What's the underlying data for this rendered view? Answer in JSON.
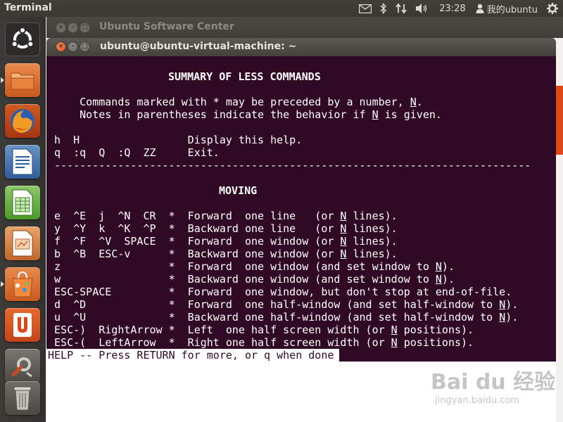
{
  "top_panel": {
    "app_name": "Terminal",
    "clock": "23:28",
    "user": "我的ubuntu",
    "icons": [
      "mail-icon",
      "bluetooth-icon",
      "network-icon",
      "volume-icon",
      "user-icon",
      "gear-icon"
    ]
  },
  "launcher": {
    "items": [
      {
        "name": "dash-home-button",
        "icon": "ubuntu-logo-icon"
      },
      {
        "name": "files-button",
        "icon": "folder-icon"
      },
      {
        "name": "firefox-button",
        "icon": "firefox-icon"
      },
      {
        "name": "writer-button",
        "icon": "writer-icon"
      },
      {
        "name": "calc-button",
        "icon": "calc-icon"
      },
      {
        "name": "impress-button",
        "icon": "impress-icon"
      },
      {
        "name": "software-center-button",
        "icon": "software-center-icon"
      },
      {
        "name": "ubuntu-one-button",
        "icon": "ubuntu-one-icon"
      },
      {
        "name": "system-settings-button",
        "icon": "settings-icon"
      },
      {
        "name": "trash-button",
        "icon": "trash-icon"
      }
    ]
  },
  "background_window": {
    "title": "Ubuntu Software Center"
  },
  "terminal": {
    "title": "ubuntu@ubuntu-virtual-machine: ~",
    "lines": {
      "l1": "SUMMARY OF LESS COMMANDS",
      "l2a": "     Commands marked with * may be preceded by a number, ",
      "l2n": "N",
      "l2b": ".",
      "l3a": "     Notes in parentheses indicate the behavior if ",
      "l3n": "N",
      "l3b": " is given.",
      "l4": " h  H                 Display this help.",
      "l5": " q  :q  Q  :Q  ZZ     Exit.",
      "l6": "---------------------------------------------------------------------------",
      "l7": "MOVING",
      "m1a": " e  ^E  j  ^N  CR  *  Forward  one line   (or ",
      "m1b": " lines).",
      "m2a": " y  ^Y  k  ^K  ^P  *  Backward one line   (or ",
      "m2b": " lines).",
      "m3a": " f  ^F  ^V  SPACE  *  Forward  one window (or ",
      "m3b": " lines).",
      "m4a": " b  ^B  ESC-v      *  Backward one window (or ",
      "m4b": " lines).",
      "m5a": " z                 *  Forward  one window (and set window to ",
      "m5b": ").",
      "m6a": " w                 *  Backward one window (and set window to ",
      "m6b": ").",
      "m7": " ESC-SPACE         *  Forward  one window, but don't stop at end-of-file.",
      "m8a": " d  ^D             *  Forward  one half-window (and set half-window to ",
      "m8b": ").",
      "m9a": " u  ^U             *  Backward one half-window (and set half-window to ",
      "m9b": ").",
      "m10a": " ESC-)  RightArrow *  Left  one half screen width (or ",
      "m10b": " positions).",
      "m11a": " ESC-(  LeftArrow  *  Right one half screen width (or ",
      "m11b": " positions).",
      "n": "N"
    },
    "status": "HELP -- Press RETURN for more, or q when done"
  },
  "watermark": {
    "logo": "Bai du 经验",
    "sub": "jingyan.baidu.com"
  }
}
